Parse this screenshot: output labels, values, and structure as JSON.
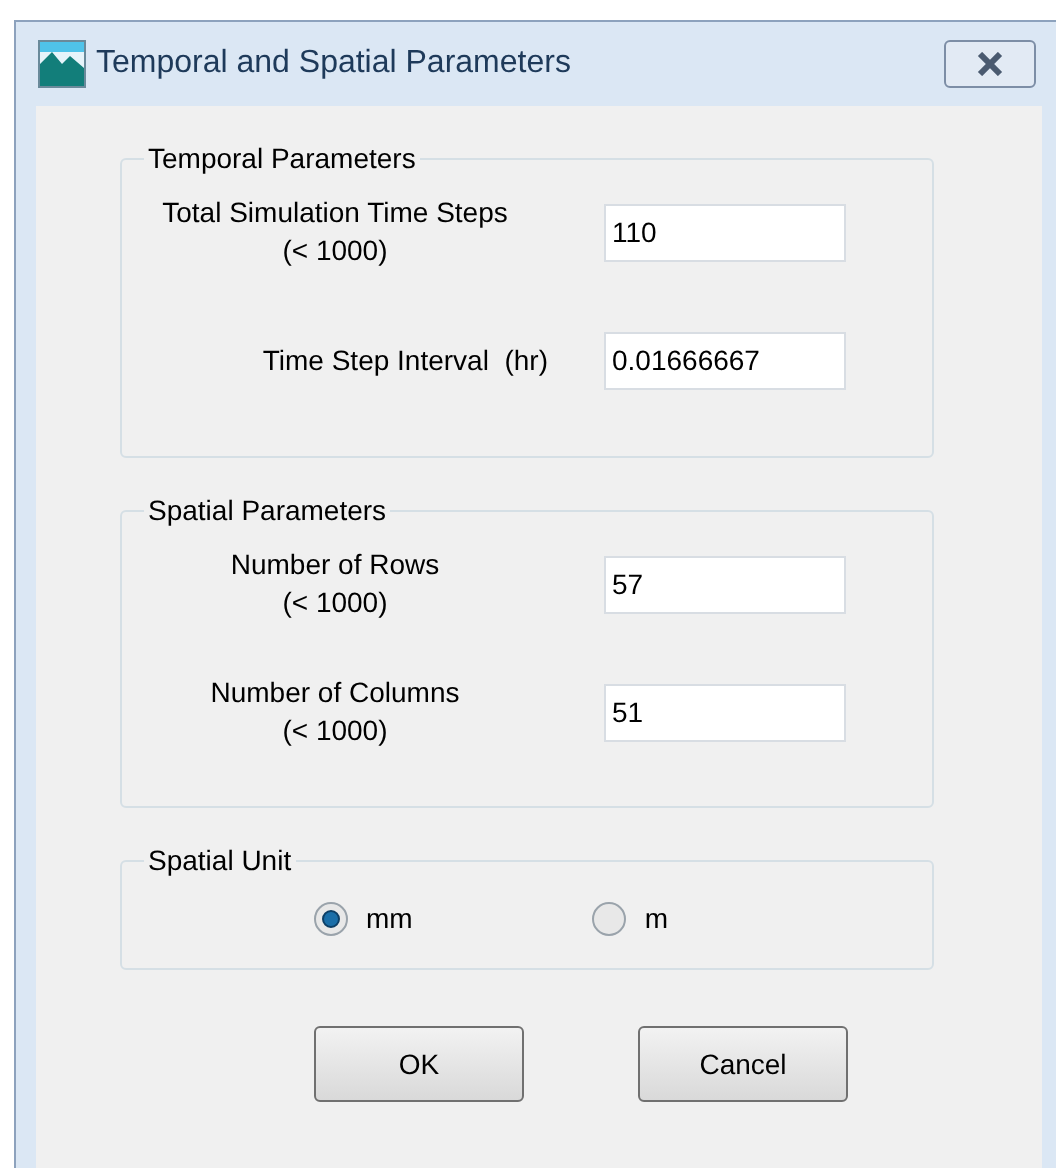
{
  "window": {
    "title": "Temporal and Spatial Parameters"
  },
  "groups": [
    {
      "kind": "fields",
      "title": "Temporal Parameters",
      "fields": [
        {
          "label": "Total Simulation Time Steps",
          "hint": "(< 1000)",
          "value": "110"
        },
        {
          "label": "Time Step Interval  (hr)",
          "value": "0.01666667"
        }
      ]
    },
    {
      "kind": "fields",
      "title": "Spatial Parameters",
      "fields": [
        {
          "label": "Number of Rows",
          "hint": "(< 1000)",
          "value": "57"
        },
        {
          "label": "Number of Columns",
          "hint": "(< 1000)",
          "value": "51"
        }
      ]
    },
    {
      "kind": "radios",
      "title": "Spatial Unit",
      "options": [
        {
          "label": "mm",
          "selected": true
        },
        {
          "label": "m",
          "selected": false
        }
      ]
    }
  ],
  "buttons": [
    "OK",
    "Cancel"
  ]
}
